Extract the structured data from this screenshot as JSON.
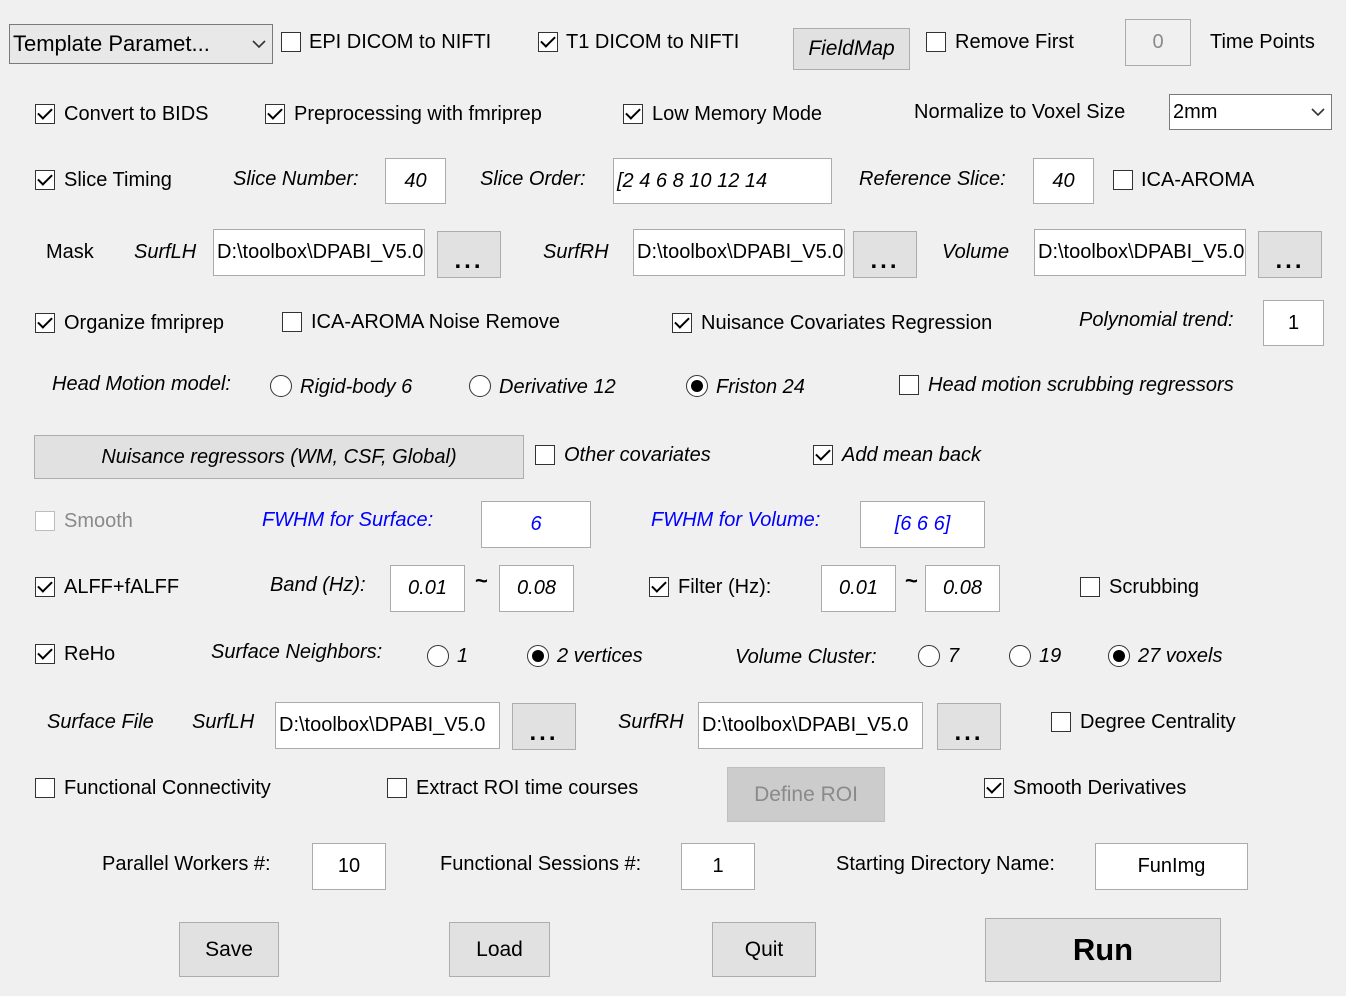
{
  "top": {
    "template_select": "Template Paramet...",
    "epi_dicom": {
      "label": "EPI DICOM to NIFTI",
      "checked": false
    },
    "t1_dicom": {
      "label": "T1 DICOM to NIFTI",
      "checked": true
    },
    "fieldmap_button": "FieldMap",
    "remove_first": {
      "label": "Remove First",
      "checked": false
    },
    "remove_first_value": "0",
    "time_points": "Time Points"
  },
  "row2": {
    "convert_bids": {
      "label": "Convert to BIDS",
      "checked": true
    },
    "fmriprep": {
      "label": "Preprocessing with fmriprep",
      "checked": true
    },
    "low_memory": {
      "label": "Low Memory Mode",
      "checked": true
    },
    "normalize_label": "Normalize to Voxel Size",
    "normalize_value": "2mm"
  },
  "row3": {
    "slice_timing": {
      "label": "Slice Timing",
      "checked": true
    },
    "slice_number_label": "Slice Number:",
    "slice_number": "40",
    "slice_order_label": "Slice Order:",
    "slice_order": "[2   4   6   8  10  12  14",
    "reference_slice_label": "Reference Slice:",
    "reference_slice": "40",
    "ica_aroma": {
      "label": "ICA-AROMA",
      "checked": false
    }
  },
  "mask": {
    "label": "Mask",
    "surflh_label": "SurfLH",
    "surflh_value": "D:\\toolbox\\DPABI_V5.0",
    "surfrh_label": "SurfRH",
    "surfrh_value": "D:\\toolbox\\DPABI_V5.0",
    "volume_label": "Volume",
    "volume_value": "D:\\toolbox\\DPABI_V5.0",
    "browse": "..."
  },
  "row5": {
    "organize": {
      "label": "Organize fmriprep",
      "checked": true
    },
    "ica_noise": {
      "label": "ICA-AROMA Noise Remove",
      "checked": false
    },
    "nuisance_reg": {
      "label": "Nuisance Covariates Regression",
      "checked": true
    },
    "polynomial_label": "Polynomial trend:",
    "polynomial_value": "1"
  },
  "headmotion": {
    "label": "Head Motion model:",
    "rigid": {
      "label": "Rigid-body 6",
      "checked": false
    },
    "derivative": {
      "label": "Derivative 12",
      "checked": false
    },
    "friston": {
      "label": "Friston 24",
      "checked": true
    },
    "scrubbing_regressors": {
      "label": "Head motion scrubbing regressors",
      "checked": false
    }
  },
  "nuisance": {
    "button": "Nuisance regressors (WM, CSF, Global)",
    "other_cov": {
      "label": "Other covariates",
      "checked": false
    },
    "add_mean": {
      "label": "Add mean back",
      "checked": true
    }
  },
  "smooth": {
    "smooth": {
      "label": "Smooth",
      "checked": false
    },
    "fwhm_surface_label": "FWHM for Surface:",
    "fwhm_surface": "6",
    "fwhm_volume_label": "FWHM for Volume:",
    "fwhm_volume": "[6  6  6]"
  },
  "alff": {
    "alff": {
      "label": "ALFF+fALFF",
      "checked": true
    },
    "band_label": "Band (Hz):",
    "band_low": "0.01",
    "band_high": "0.08",
    "tilde": "~",
    "filter": {
      "label": "Filter (Hz):",
      "checked": true
    },
    "filter_low": "0.01",
    "filter_high": "0.08",
    "scrubbing": {
      "label": "Scrubbing",
      "checked": false
    }
  },
  "reho": {
    "reho": {
      "label": "ReHo",
      "checked": true
    },
    "surface_neighbors_label": "Surface Neighbors:",
    "n1": {
      "label": "1",
      "checked": false
    },
    "n2": {
      "label": "2 vertices",
      "checked": true
    },
    "volume_cluster_label": "Volume Cluster:",
    "c7": {
      "label": "7",
      "checked": false
    },
    "c19": {
      "label": "19",
      "checked": false
    },
    "c27": {
      "label": "27 voxels",
      "checked": true
    }
  },
  "surface_file": {
    "label": "Surface File",
    "surflh_label": "SurfLH",
    "surflh_value": "D:\\toolbox\\DPABI_V5.0",
    "surfrh_label": "SurfRH",
    "surfrh_value": "D:\\toolbox\\DPABI_V5.0",
    "degree": {
      "label": "Degree Centrality",
      "checked": false
    }
  },
  "fc": {
    "fc": {
      "label": "Functional Connectivity",
      "checked": false
    },
    "extract_roi": {
      "label": "Extract ROI time courses",
      "checked": false
    },
    "define_roi": "Define ROI",
    "smooth_deriv": {
      "label": "Smooth Derivatives",
      "checked": true
    }
  },
  "bottom": {
    "workers_label": "Parallel Workers #:",
    "workers": "10",
    "sessions_label": "Functional Sessions #:",
    "sessions": "1",
    "start_dir_label": "Starting Directory Name:",
    "start_dir": "FunImg"
  },
  "actions": {
    "save": "Save",
    "load": "Load",
    "quit": "Quit",
    "run": "Run"
  }
}
